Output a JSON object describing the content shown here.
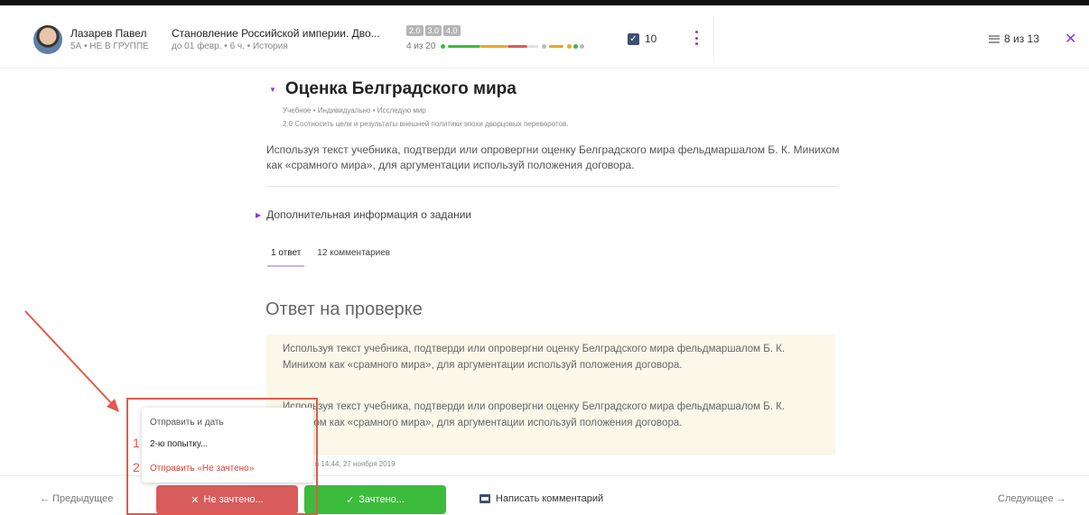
{
  "header": {
    "student_name": "Лазарев Павел",
    "student_meta": "5А • НЕ В ГРУППЕ",
    "course_title": "Становление Российской империи. Дво...",
    "course_meta": "до 01 февр. • 6 ч. • История",
    "grade_badges": [
      "2.0",
      "3.0",
      "4.0"
    ],
    "progress_count": "4 из 20",
    "checked_count": "10",
    "position": "8 из 13"
  },
  "task": {
    "title": "Оценка Белградского мира",
    "tags": "Учебное • Индивидуально • Исследую мир",
    "objective": "2.0 Соотносить цели и результаты внешней политики эпохи дворцовых переворотов.",
    "text": "Используя текст учебника, подтверди или опровергни оценку Белградского мира фельдмаршалом Б. К. Минихом как «срамного мира», для аргументации используй положения договора.",
    "additional_info": "Дополнительная информация о задании"
  },
  "tabs": [
    {
      "label": "1 ответ"
    },
    {
      "label": "12 комментариев"
    }
  ],
  "answer": {
    "heading": "Ответ на проверке",
    "paragraph_1": "Используя текст учебника, подтверди или опровергни оценку Белградского мира фельдмаршалом Б. К. Минихом как «срамного мира», для аргументации используй положения договора.",
    "paragraph_2": "Используя текст учебника, подтверди или опровергни оценку Белградского мира фельдмаршалом Б. К. Минихом как «срамного мира», для аргументации используй положения договора.",
    "time": "в 14:44, 27 ноября 2019"
  },
  "dropdown": {
    "item_1": "Отправить и дать",
    "item_2": "2-ю попытку...",
    "item_3": "Отправить «Не зачтено»",
    "num_1": "1",
    "num_2": "2"
  },
  "bottom": {
    "prev": "Предыдущее",
    "next": "Следующее",
    "fail_button": "Не зачтено...",
    "pass_button": "Зачтено...",
    "comment_button": "Написать комментарий"
  },
  "colors": {
    "accent": "#7b3fe4",
    "fail": "#d85c5c",
    "pass": "#3cbb3c",
    "annotation": "#e05a4d"
  }
}
